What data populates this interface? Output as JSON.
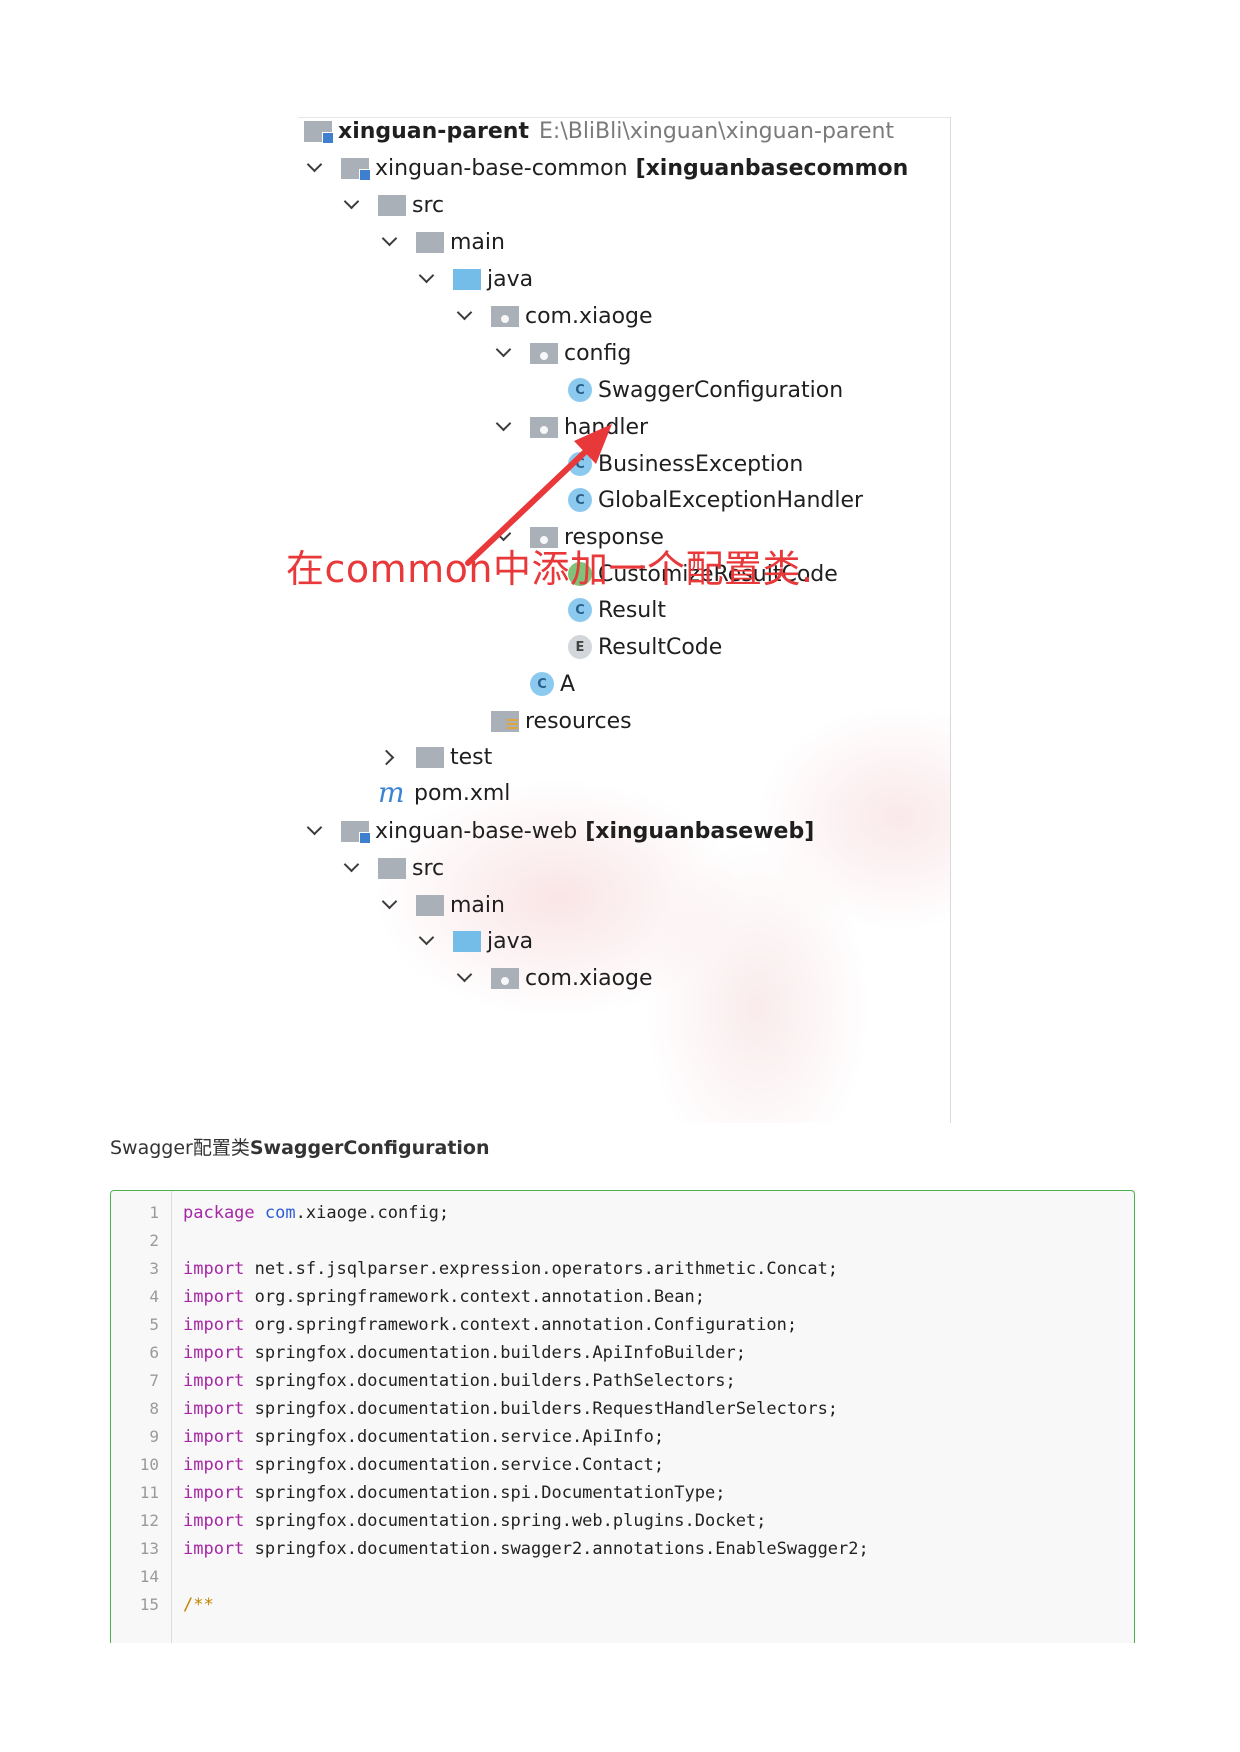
{
  "tree": {
    "root": {
      "name": "xinguan-parent",
      "path": "E:\\BliBli\\xinguan\\xinguan-parent"
    },
    "module_common": {
      "name": "xinguan-base-common",
      "tag": "[xinguanbasecommon"
    },
    "src": "src",
    "main": "main",
    "java": "java",
    "package": "com.xiaoge",
    "config": "config",
    "swagger_config": "SwaggerConfiguration",
    "handler": "handler",
    "business_exception": "BusinessException",
    "global_exception_handler": "GlobalExceptionHandler",
    "response": "response",
    "customize_result_code": "CustomizeResultCode",
    "result": "Result",
    "result_code": "ResultCode",
    "class_a": "A",
    "resources": "resources",
    "test": "test",
    "pom": "pom.xml",
    "module_web": {
      "name": "xinguan-base-web",
      "tag": "[xinguanbaseweb]"
    },
    "web_src": "src",
    "web_main": "main",
    "web_java": "java",
    "web_package": "com.xiaoge",
    "class_icon_letter": "C",
    "enum_icon_letter": "E",
    "maven_icon_letter": "m"
  },
  "annotation": {
    "text": "在common中添加一个配置类.",
    "color": "#e8383a"
  },
  "caption": {
    "prefix": "Swagger配置类",
    "strong": "SwaggerConfiguration"
  },
  "code": {
    "border_color": "#4caf50",
    "lines": [
      {
        "num": "1",
        "kw": "package",
        "rest": " ",
        "pkg": "com",
        "tail": ".xiaoge.config;"
      },
      {
        "num": "2",
        "text": ""
      },
      {
        "num": "3",
        "kw": "import",
        "rest": " net.sf.jsqlparser.expression.operators.arithmetic.Concat;"
      },
      {
        "num": "4",
        "kw": "import",
        "rest": " org.springframework.context.annotation.Bean;"
      },
      {
        "num": "5",
        "kw": "import",
        "rest": " org.springframework.context.annotation.Configuration;"
      },
      {
        "num": "6",
        "kw": "import",
        "rest": " springfox.documentation.builders.ApiInfoBuilder;"
      },
      {
        "num": "7",
        "kw": "import",
        "rest": " springfox.documentation.builders.PathSelectors;"
      },
      {
        "num": "8",
        "kw": "import",
        "rest": " springfox.documentation.builders.RequestHandlerSelectors;"
      },
      {
        "num": "9",
        "kw": "import",
        "rest": " springfox.documentation.service.ApiInfo;"
      },
      {
        "num": "10",
        "kw": "import",
        "rest": " springfox.documentation.service.Contact;"
      },
      {
        "num": "11",
        "kw": "import",
        "rest": " springfox.documentation.spi.DocumentationType;"
      },
      {
        "num": "12",
        "kw": "import",
        "rest": " springfox.documentation.spring.web.plugins.Docket;"
      },
      {
        "num": "13",
        "kw": "import",
        "rest": " springfox.documentation.swagger2.annotations.EnableSwagger2;"
      },
      {
        "num": "14",
        "text": ""
      },
      {
        "num": "15",
        "comment": "/**"
      }
    ]
  }
}
